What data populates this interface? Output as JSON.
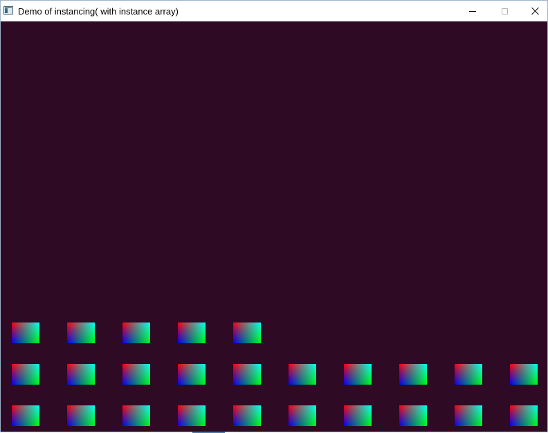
{
  "window": {
    "title": "Demo of instancing( with instance array)",
    "icon": "app-window-icon",
    "controls": {
      "minimize_icon": "minimize-icon",
      "maximize_icon": "maximize-icon",
      "close_icon": "close-icon"
    }
  },
  "scene": {
    "clear_color": "#2e0a24",
    "quad_corner_colors": {
      "top_left": "#ff0000",
      "top_right": "#00ffff",
      "bottom_left": "#0000ff",
      "bottom_right": "#00ff00"
    },
    "rows": [
      {
        "quad_count": 5
      },
      {
        "quad_count": 10
      },
      {
        "quad_count": 10
      }
    ]
  }
}
